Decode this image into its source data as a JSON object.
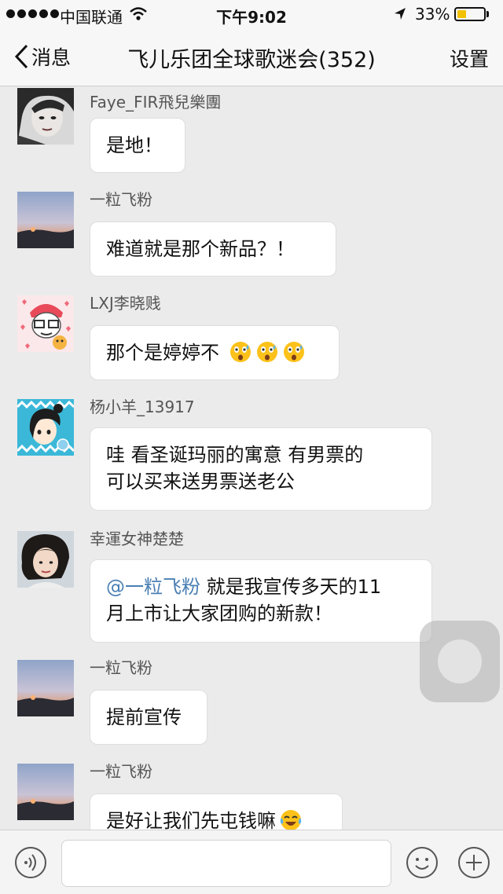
{
  "status_bar": {
    "carrier": "中国联通",
    "time": "下午9:02",
    "battery_percent": "33%",
    "battery_level": 0.33,
    "icons": [
      "signal-dots-icon",
      "wifi-icon",
      "location-arrow-icon",
      "battery-icon"
    ]
  },
  "nav": {
    "back_label": "消息",
    "title": "飞儿乐团全球歌迷会(352)",
    "settings_label": "设置"
  },
  "messages": [
    {
      "sender": "Faye_FIR飛兒樂團",
      "text": "是地！"
    },
    {
      "sender": "一粒飞粉",
      "text": "难道就是那个新品？！"
    },
    {
      "sender": "LXJ李晓贱",
      "text": "那个是婷婷不",
      "emojis": [
        "astonished-emoji",
        "astonished-emoji",
        "astonished-emoji"
      ]
    },
    {
      "sender": "杨小羊_13917",
      "line1": "哇 看圣诞玛丽的寓意 有男票的",
      "line2": "可以买来送男票送老公"
    },
    {
      "sender": "幸運女神楚楚",
      "mention": "@一粒飞粉",
      "line1": " 就是我宣传多天的11",
      "line2": "月上市让大家团购的新款！"
    },
    {
      "sender": "一粒飞粉",
      "text": "提前宣传"
    },
    {
      "sender": "一粒飞粉",
      "text": "是好让我们先屯钱嘛",
      "emojis": [
        "tears-of-joy-emoji"
      ]
    }
  ],
  "input_bar": {
    "icons": [
      "voice-icon",
      "emoji-face-icon",
      "plus-icon"
    ],
    "placeholder": ""
  },
  "colors": {
    "background": "#ebebeb",
    "bar": "#f7f7f7",
    "mention": "#4a7fb3",
    "battery": "#f2c200"
  }
}
